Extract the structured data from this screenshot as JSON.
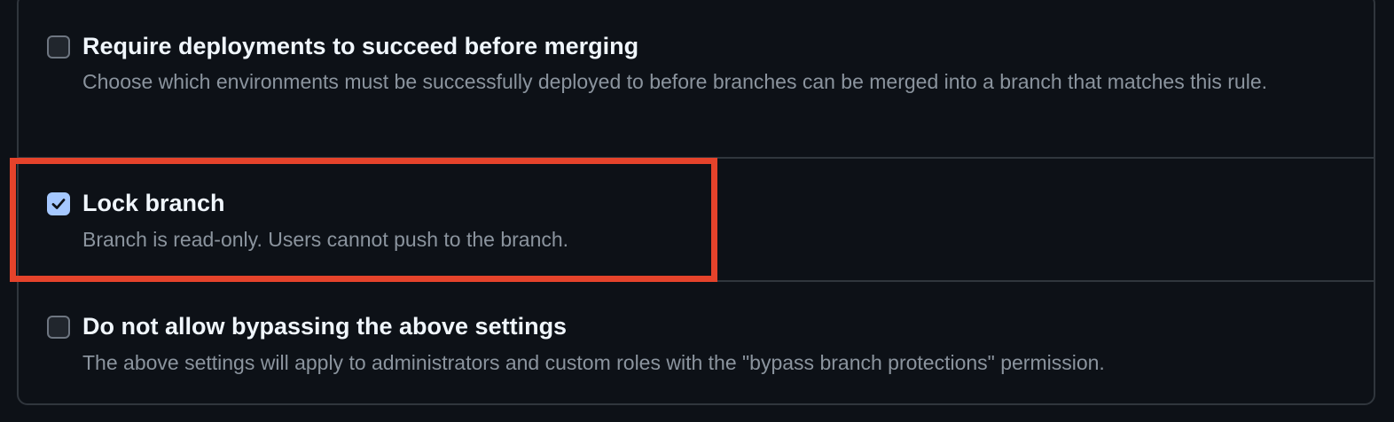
{
  "rules": [
    {
      "title": "Require deployments to succeed before merging",
      "description": "Choose which environments must be successfully deployed to before branches can be merged into a branch that matches this rule.",
      "checked": false
    },
    {
      "title": "Lock branch",
      "description": "Branch is read-only. Users cannot push to the branch.",
      "checked": true
    },
    {
      "title": "Do not allow bypassing the above settings",
      "description": "The above settings will apply to administrators and custom roles with the \"bypass branch protections\" permission.",
      "checked": false
    }
  ],
  "colors": {
    "background": "#0d1117",
    "border": "#30363d",
    "checkbox_checked": "#a5c8ff",
    "highlight": "#e5432b",
    "title": "#f0f6fc",
    "description": "#8b949e"
  }
}
